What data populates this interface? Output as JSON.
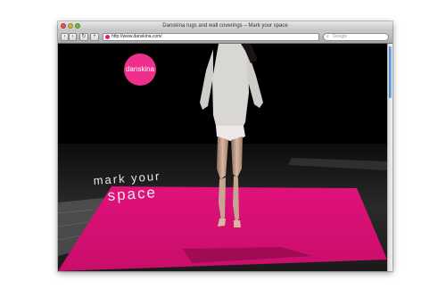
{
  "window": {
    "title": "Danskina rugs and wall coverings – Mark your space"
  },
  "toolbar": {
    "back_icon": "‹",
    "forward_icon": "›",
    "reload_icon": "↻",
    "add_icon": "+",
    "url": "http://www.danskina.com/",
    "search_icon": "⌕",
    "search_placeholder": "Google"
  },
  "page": {
    "logo_text": "danskina",
    "tagline_line1": "mark your",
    "tagline_line2": "space"
  },
  "colors": {
    "brand_pink": "#ef2f8c",
    "rug_pink": "#e8157d",
    "background": "#000000"
  }
}
